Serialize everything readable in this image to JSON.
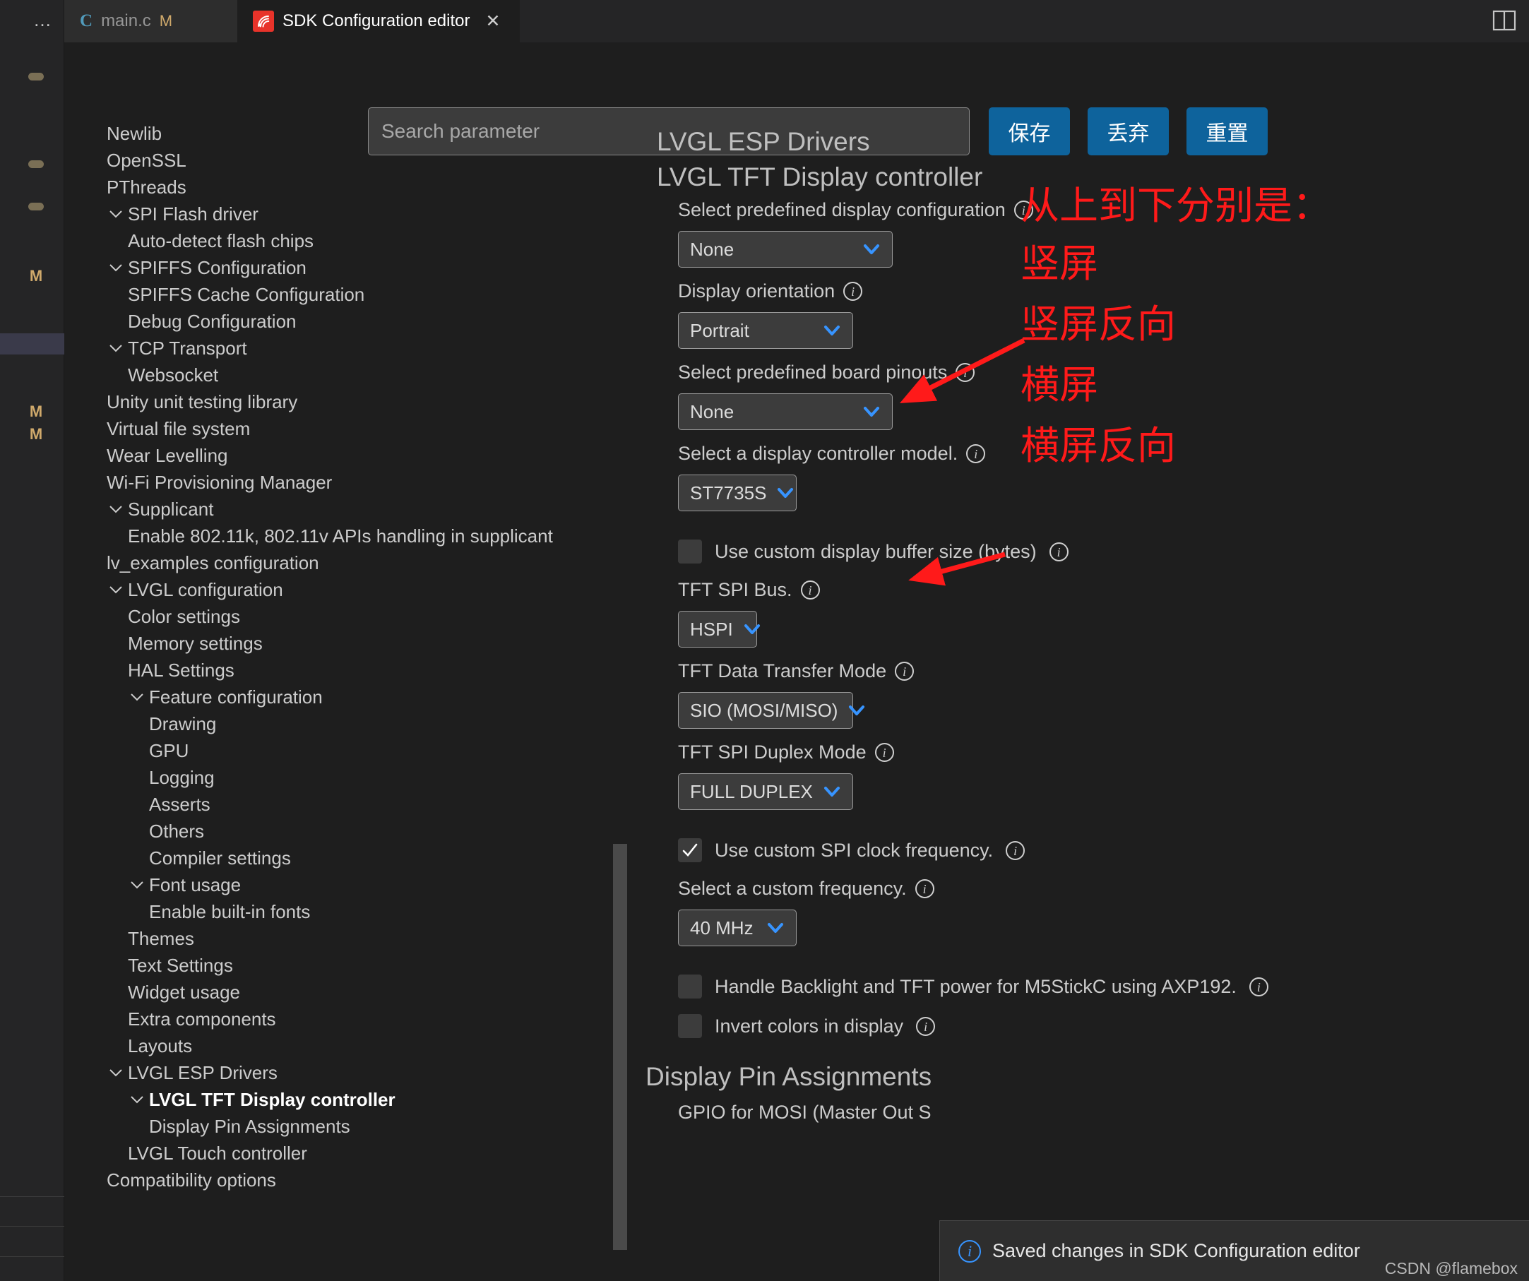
{
  "window": {
    "overflow_menu": "…",
    "split_editor_icon": "split-editor-icon"
  },
  "tabs": [
    {
      "label": "main.c",
      "badge": "M",
      "icon": "c-file-icon",
      "active": false
    },
    {
      "label": "SDK Configuration editor",
      "badge": "",
      "icon": "espressif-icon",
      "active": true,
      "close": "✕"
    }
  ],
  "toolbar": {
    "search_placeholder": "Search parameter",
    "search_value": "",
    "save_label": "保存",
    "discard_label": "丢弃",
    "reset_label": "重置",
    "accent_color": "#0e639c"
  },
  "sidebar": {
    "items": [
      {
        "label": "Newlib",
        "indent": 0,
        "chevron": false,
        "bold": false
      },
      {
        "label": "OpenSSL",
        "indent": 0,
        "chevron": false,
        "bold": false
      },
      {
        "label": "PThreads",
        "indent": 0,
        "chevron": false,
        "bold": false
      },
      {
        "label": "SPI Flash driver",
        "indent": 1,
        "chevron": true,
        "bold": false
      },
      {
        "label": "Auto-detect flash chips",
        "indent": 1,
        "chevron": false,
        "bold": false
      },
      {
        "label": "SPIFFS Configuration",
        "indent": 1,
        "chevron": true,
        "bold": false
      },
      {
        "label": "SPIFFS Cache Configuration",
        "indent": 1,
        "chevron": false,
        "bold": false
      },
      {
        "label": "Debug Configuration",
        "indent": 1,
        "chevron": false,
        "bold": false
      },
      {
        "label": "TCP Transport",
        "indent": 1,
        "chevron": true,
        "bold": false
      },
      {
        "label": "Websocket",
        "indent": 1,
        "chevron": false,
        "bold": false
      },
      {
        "label": "Unity unit testing library",
        "indent": 0,
        "chevron": false,
        "bold": false
      },
      {
        "label": "Virtual file system",
        "indent": 0,
        "chevron": false,
        "bold": false
      },
      {
        "label": "Wear Levelling",
        "indent": 0,
        "chevron": false,
        "bold": false
      },
      {
        "label": "Wi-Fi Provisioning Manager",
        "indent": 0,
        "chevron": false,
        "bold": false
      },
      {
        "label": "Supplicant",
        "indent": 1,
        "chevron": true,
        "bold": false
      },
      {
        "label": "Enable 802.11k, 802.11v APIs handling in supplicant",
        "indent": 1,
        "chevron": false,
        "bold": false
      },
      {
        "label": "lv_examples configuration",
        "indent": 0,
        "chevron": false,
        "bold": false
      },
      {
        "label": "LVGL configuration",
        "indent": 1,
        "chevron": true,
        "bold": false
      },
      {
        "label": "Color settings",
        "indent": 1,
        "chevron": false,
        "bold": false
      },
      {
        "label": "Memory settings",
        "indent": 1,
        "chevron": false,
        "bold": false
      },
      {
        "label": "HAL Settings",
        "indent": 1,
        "chevron": false,
        "bold": false
      },
      {
        "label": "Feature configuration",
        "indent": 2,
        "chevron": true,
        "bold": false
      },
      {
        "label": "Drawing",
        "indent": 2,
        "chevron": false,
        "bold": false
      },
      {
        "label": "GPU",
        "indent": 2,
        "chevron": false,
        "bold": false
      },
      {
        "label": "Logging",
        "indent": 2,
        "chevron": false,
        "bold": false
      },
      {
        "label": "Asserts",
        "indent": 2,
        "chevron": false,
        "bold": false
      },
      {
        "label": "Others",
        "indent": 2,
        "chevron": false,
        "bold": false
      },
      {
        "label": "Compiler settings",
        "indent": 2,
        "chevron": false,
        "bold": false
      },
      {
        "label": "Font usage",
        "indent": 2,
        "chevron": true,
        "bold": false
      },
      {
        "label": "Enable built-in fonts",
        "indent": 2,
        "chevron": false,
        "bold": false
      },
      {
        "label": "Themes",
        "indent": 1,
        "chevron": false,
        "bold": false
      },
      {
        "label": "Text Settings",
        "indent": 1,
        "chevron": false,
        "bold": false
      },
      {
        "label": "Widget usage",
        "indent": 1,
        "chevron": false,
        "bold": false
      },
      {
        "label": "Extra components",
        "indent": 1,
        "chevron": false,
        "bold": false
      },
      {
        "label": "Layouts",
        "indent": 1,
        "chevron": false,
        "bold": false
      },
      {
        "label": "LVGL ESP Drivers",
        "indent": 1,
        "chevron": true,
        "bold": false
      },
      {
        "label": "LVGL TFT Display controller",
        "indent": 2,
        "chevron": true,
        "bold": true
      },
      {
        "label": "Display Pin Assignments",
        "indent": 2,
        "chevron": false,
        "bold": false
      },
      {
        "label": "LVGL Touch controller",
        "indent": 1,
        "chevron": false,
        "bold": false
      },
      {
        "label": "Compatibility options",
        "indent": 0,
        "chevron": false,
        "bold": false
      }
    ]
  },
  "main": {
    "heading_1": "LVGL ESP Drivers",
    "heading_2": "LVGL TFT Display controller",
    "fields": [
      {
        "label": "Select predefined display configuration",
        "value": "None",
        "kind": "select",
        "width": "wide"
      },
      {
        "label": "Display orientation",
        "value": "Portrait",
        "kind": "select",
        "width": "mid"
      },
      {
        "label": "Select predefined board pinouts",
        "value": "None",
        "kind": "select",
        "width": "wide"
      },
      {
        "label": "Select a display controller model.",
        "value": "ST7735S",
        "kind": "select",
        "width": "narrow"
      },
      {
        "label": "Use custom display buffer size (bytes)",
        "value": "",
        "kind": "checkbox",
        "checked": false
      },
      {
        "label": "TFT SPI Bus.",
        "value": "HSPI",
        "kind": "select",
        "width": "tiny"
      },
      {
        "label": "TFT Data Transfer Mode",
        "value": "SIO (MOSI/MISO)",
        "kind": "select",
        "width": "mid"
      },
      {
        "label": "TFT SPI Duplex Mode",
        "value": "FULL DUPLEX",
        "kind": "select",
        "width": "mid"
      },
      {
        "label": "Use custom SPI clock frequency.",
        "value": "",
        "kind": "checkbox",
        "checked": true
      },
      {
        "label": "Select a custom frequency.",
        "value": "40 MHz",
        "kind": "select",
        "width": "narrow"
      },
      {
        "label": "Handle Backlight and TFT power for M5StickC using AXP192.",
        "value": "",
        "kind": "checkbox",
        "checked": false
      },
      {
        "label": "Invert colors in display",
        "value": "",
        "kind": "checkbox",
        "checked": false
      }
    ],
    "section_heading": "Display Pin Assignments",
    "truncated_field": "GPIO for MOSI (Master Out S"
  },
  "annotation": {
    "color": "#ff1a1a",
    "lines": [
      "从上到下分别是：",
      "竖屏",
      "竖屏反向",
      "横屏",
      "横屏反向"
    ]
  },
  "toast": {
    "icon": "info-icon",
    "message": "Saved changes in SDK Configuration editor"
  },
  "watermark": "CSDN @flamebox"
}
